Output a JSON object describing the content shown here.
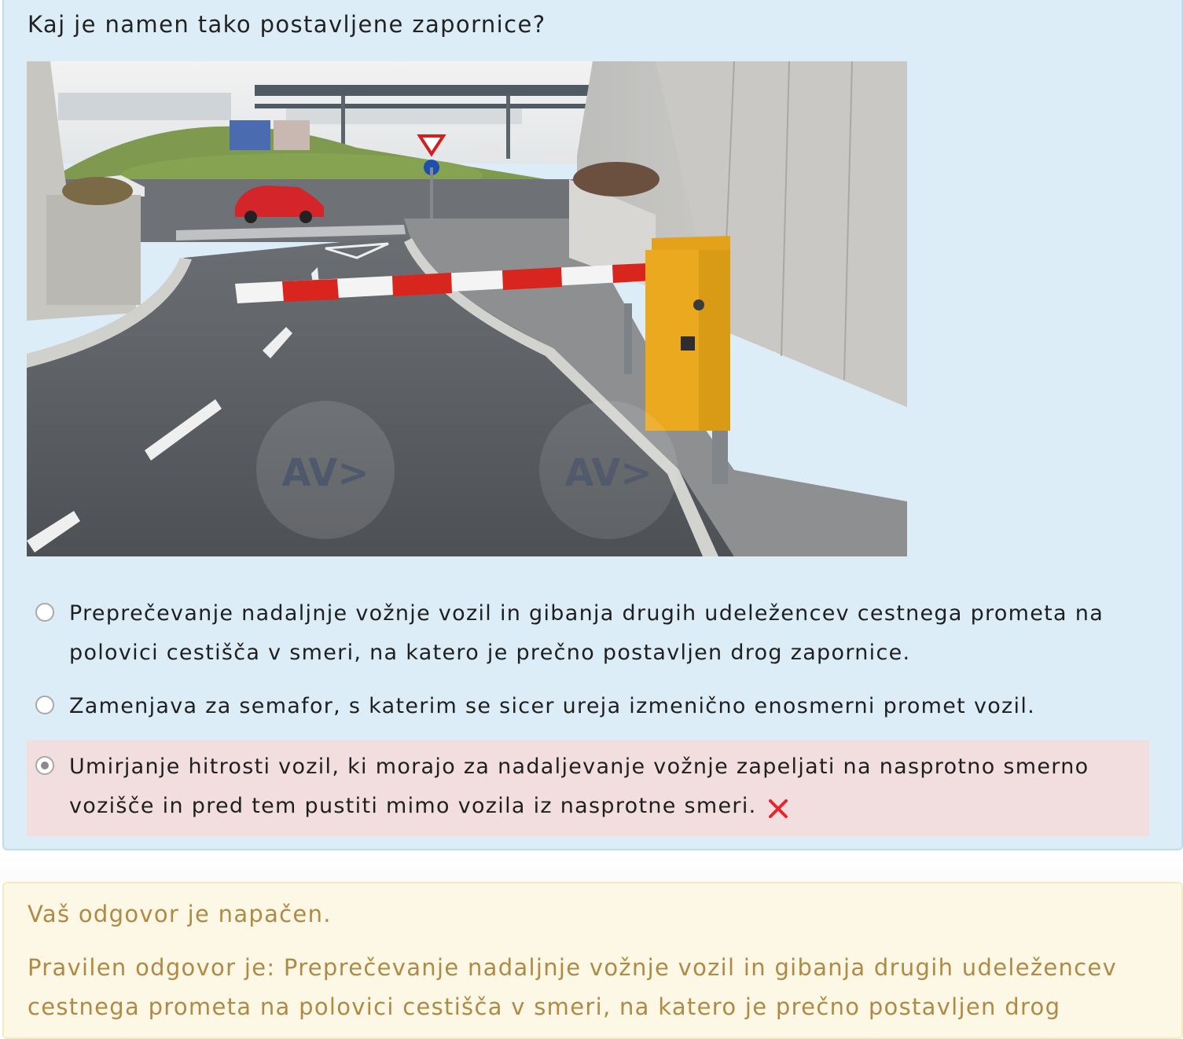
{
  "question": {
    "text": "Kaj je namen tako postavljene zapornice?"
  },
  "photo": {
    "watermark_logo_text": "AV>"
  },
  "answers": [
    {
      "text": "Preprečevanje nadaljnje vožnje vozil in gibanja drugih udeležencev cestnega prometa na polovici cestišča v smeri, na katero je prečno postavljen drog zapornice.",
      "selected": false
    },
    {
      "text": "Zamenjava za semafor, s katerim se sicer ureja izmenično enosmerni promet vozil.",
      "selected": false
    },
    {
      "text": "Umirjanje hitrosti vozil, ki morajo za nadaljevanje vožnje zapeljati na nasprotno smerno vozišče in pred tem pustiti mimo vozila iz nasprotne smeri.",
      "selected": true,
      "status": "wrong"
    }
  ],
  "icons": {
    "wrong": "close-icon"
  },
  "feedback": {
    "incorrect_text": "Vaš odgovor je napačen.",
    "correct_answer_text": "Pravilen odgovor je: Preprečevanje nadaljnje vožnje vozil in gibanja drugih udeležencev cestnega prometa na polovici cestišča v smeri, na katero je prečno postavljen drog"
  },
  "colors": {
    "question_bg": "#dcedf7",
    "wrong_bg": "#f2dede",
    "wrong_mark": "#e8242c",
    "feedback_bg": "#fcf8e5",
    "feedback_text": "#b08a45"
  }
}
